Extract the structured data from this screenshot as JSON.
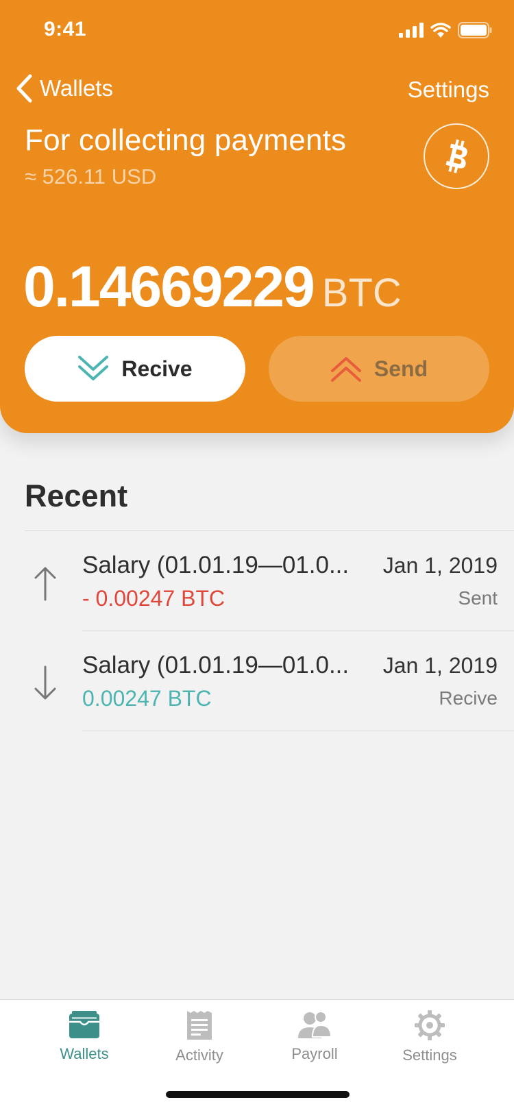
{
  "status_bar": {
    "time": "9:41"
  },
  "nav": {
    "back_label": "Wallets",
    "settings_label": "Settings"
  },
  "wallet": {
    "title": "For collecting payments",
    "fiat_estimate": "≈ 526.11 USD",
    "balance": "0.14669229",
    "unit": "BTC",
    "coin_icon": "bitcoin-icon"
  },
  "actions": {
    "receive_label": "Recive",
    "send_label": "Send"
  },
  "recent": {
    "title": "Recent",
    "transactions": [
      {
        "name": "Salary (01.01.19—01.0...",
        "date": "Jan 1, 2019",
        "amount": "- 0.00247 BTC",
        "status": "Sent",
        "direction": "up-arrow-icon"
      },
      {
        "name": "Salary (01.01.19—01.0...",
        "date": "Jan 1, 2019",
        "amount": "0.00247 BTC",
        "status": "Recive",
        "direction": "down-arrow-icon"
      }
    ]
  },
  "tabbar": {
    "tabs": [
      {
        "label": "Wallets",
        "icon": "wallet-icon",
        "active": true
      },
      {
        "label": "Activity",
        "icon": "receipt-icon",
        "active": false
      },
      {
        "label": "Payroll",
        "icon": "people-icon",
        "active": false
      },
      {
        "label": "Settings",
        "icon": "gear-icon",
        "active": false
      }
    ]
  },
  "colors": {
    "header": "#ec8c1c",
    "accent_teal": "#4cb5b2",
    "sent_red": "#e0473b",
    "active_tab": "#3d8f8a"
  }
}
